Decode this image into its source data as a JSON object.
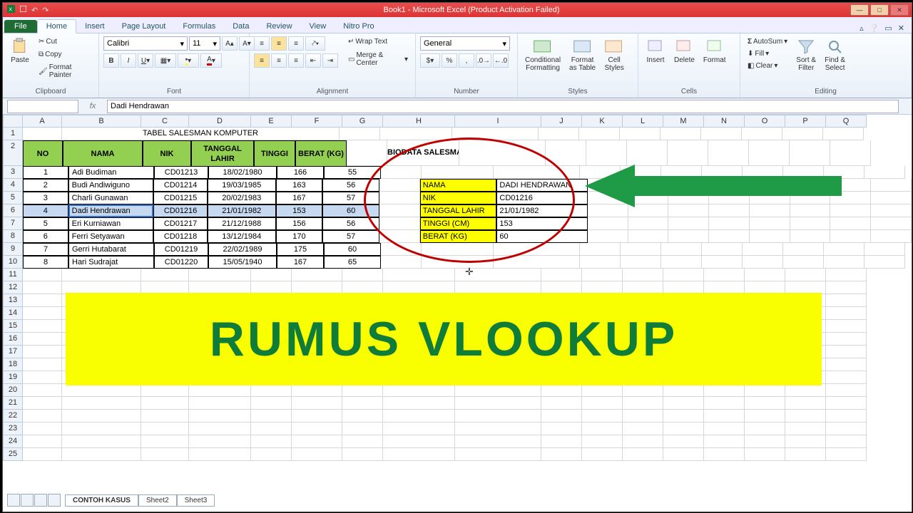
{
  "title": "Book1 - Microsoft Excel (Product Activation Failed)",
  "tabs": {
    "file": "File",
    "items": [
      "Home",
      "Insert",
      "Page Layout",
      "Formulas",
      "Data",
      "Review",
      "View",
      "Nitro Pro"
    ],
    "active": "Home"
  },
  "ribbon": {
    "clipboard": {
      "label": "Clipboard",
      "paste": "Paste",
      "cut": "Cut",
      "copy": "Copy",
      "fp": "Format Painter"
    },
    "font": {
      "label": "Font",
      "name": "Calibri",
      "size": "11"
    },
    "alignment": {
      "label": "Alignment",
      "wrap": "Wrap Text",
      "merge": "Merge & Center"
    },
    "number": {
      "label": "Number",
      "format": "General"
    },
    "styles": {
      "label": "Styles",
      "cond": "Conditional\nFormatting",
      "table": "Format\nas Table",
      "cell": "Cell\nStyles"
    },
    "cells": {
      "label": "Cells",
      "insert": "Insert",
      "delete": "Delete",
      "format": "Format"
    },
    "editing": {
      "label": "Editing",
      "sum": "AutoSum",
      "fill": "Fill",
      "clear": "Clear",
      "sort": "Sort &\nFilter",
      "find": "Find &\nSelect"
    }
  },
  "formula_bar": {
    "name_box": "",
    "fx_value": "Dadi Hendrawan"
  },
  "columns": [
    "A",
    "B",
    "C",
    "D",
    "E",
    "F",
    "G",
    "H",
    "I",
    "J",
    "K",
    "L",
    "M",
    "N",
    "O",
    "P",
    "Q"
  ],
  "row_numbers": [
    "1",
    "2",
    "3",
    "4",
    "5",
    "6",
    "7",
    "8",
    "9",
    "10",
    "11",
    "12",
    "13",
    "14",
    "15",
    "16",
    "17",
    "18",
    "19",
    "20",
    "21",
    "22",
    "23",
    "24",
    "25"
  ],
  "table": {
    "title": "TABEL SALESMAN KOMPUTER",
    "headers": [
      "NO",
      "NAMA",
      "NIK",
      "TANGGAL LAHIR",
      "TINGGI",
      "BERAT (KG)"
    ],
    "rows": [
      [
        "1",
        "Adi Budiman",
        "CD01213",
        "18/02/1980",
        "166",
        "55"
      ],
      [
        "2",
        "Budi Andiwiguno",
        "CD01214",
        "19/03/1985",
        "163",
        "56"
      ],
      [
        "3",
        "Charli Gunawan",
        "CD01215",
        "20/02/1983",
        "167",
        "57"
      ],
      [
        "4",
        "Dadi Hendrawan",
        "CD01216",
        "21/01/1982",
        "153",
        "60"
      ],
      [
        "5",
        "Eri Kurniawan",
        "CD01217",
        "21/12/1988",
        "156",
        "56"
      ],
      [
        "6",
        "Ferri Setyawan",
        "CD01218",
        "13/12/1984",
        "170",
        "57"
      ],
      [
        "7",
        "Gerri Hutabarat",
        "CD01219",
        "22/02/1989",
        "175",
        "60"
      ],
      [
        "8",
        "Hari Sudrajat",
        "CD01220",
        "15/05/1940",
        "167",
        "65"
      ]
    ]
  },
  "biodata": {
    "title": "BIODATA SALESMAN",
    "rows": [
      [
        "NAMA",
        "DADI HENDRAWAN"
      ],
      [
        "NIK",
        "CD01216"
      ],
      [
        "TANGGAL LAHIR",
        "21/01/1982"
      ],
      [
        "TINGGI (CM)",
        "153"
      ],
      [
        "BERAT (KG)",
        "60"
      ]
    ]
  },
  "banner": "RUMUS VLOOKUP",
  "sheet_tabs": [
    "CONTOH KASUS",
    "Sheet2",
    "Sheet3"
  ]
}
